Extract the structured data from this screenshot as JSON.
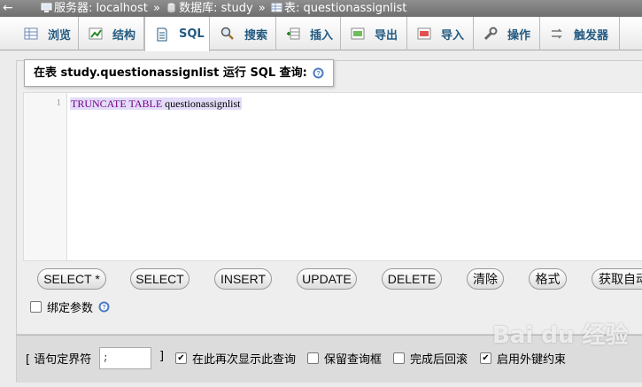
{
  "breadcrumb": {
    "back": "←",
    "server": "服务器: localhost",
    "database": "数据库: study",
    "table": "表: questionassignlist",
    "separator": "»"
  },
  "tabs": [
    {
      "label": "浏览",
      "icon": "browse-icon"
    },
    {
      "label": "结构",
      "icon": "structure-icon"
    },
    {
      "label": "SQL",
      "icon": "sql-icon",
      "active": true
    },
    {
      "label": "搜索",
      "icon": "search-icon"
    },
    {
      "label": "插入",
      "icon": "insert-icon"
    },
    {
      "label": "导出",
      "icon": "export-icon"
    },
    {
      "label": "导入",
      "icon": "import-icon"
    },
    {
      "label": "操作",
      "icon": "wrench-icon"
    },
    {
      "label": "触发器",
      "icon": "triggers-icon"
    }
  ],
  "legend": {
    "prefix": "在表",
    "table": "study.questionassignlist",
    "suffix": "运行 SQL 查询:"
  },
  "editor": {
    "line_number": "1",
    "keyword": "TRUNCATE TABLE",
    "rest": " questionassignlist"
  },
  "query_buttons": [
    "SELECT *",
    "SELECT",
    "INSERT",
    "UPDATE",
    "DELETE",
    "清除",
    "格式",
    "获取自动"
  ],
  "bind_params": {
    "label": "绑定参数",
    "checked": false
  },
  "footer": {
    "delimiter_label_open": "[ 语句定界符",
    "delimiter_value": ";",
    "delimiter_label_close": "]",
    "options": [
      {
        "label": "在此再次显示此查询",
        "checked": true
      },
      {
        "label": "保留查询框",
        "checked": false
      },
      {
        "label": "完成后回滚",
        "checked": false
      },
      {
        "label": "启用外键约束",
        "checked": true
      }
    ]
  },
  "watermark": "Bai du 经验",
  "colors": {
    "tab_text": "#235a81",
    "topbar": "#7a7a7a",
    "keyword": "#770088"
  }
}
